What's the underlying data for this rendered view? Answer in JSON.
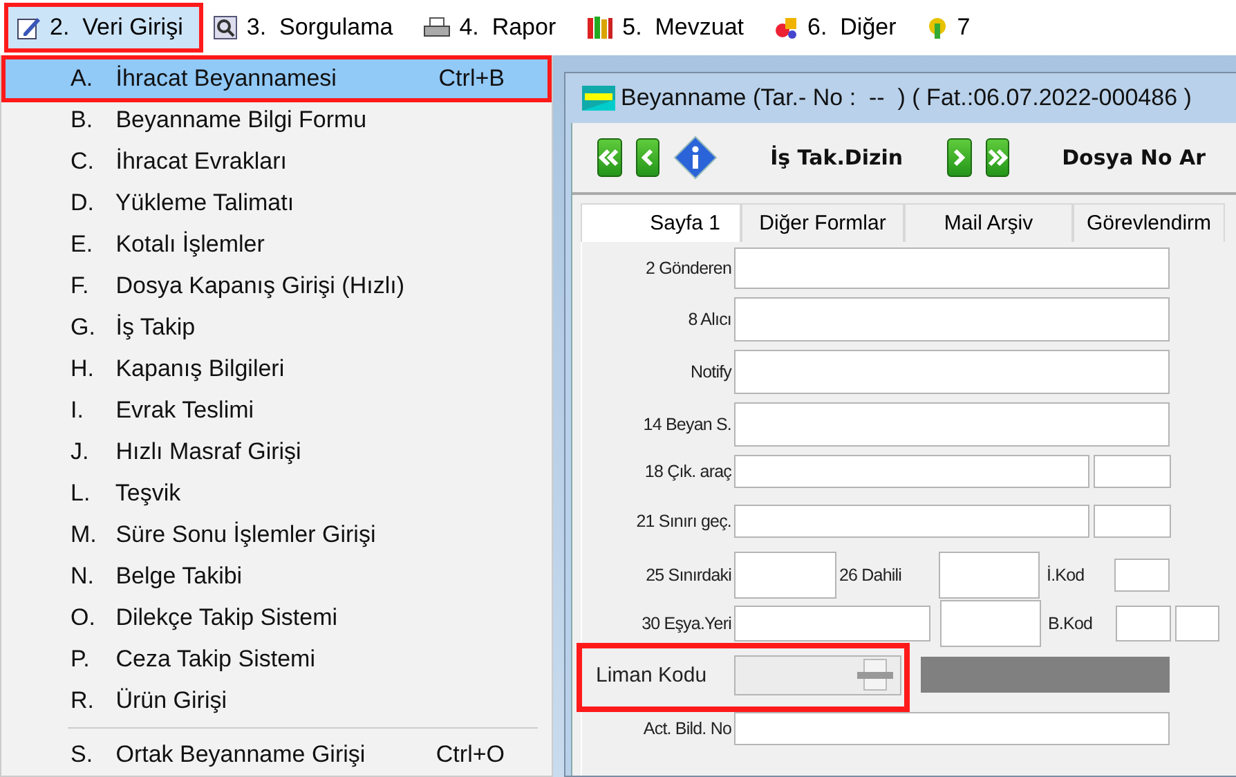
{
  "menubar": [
    {
      "label": "2.  Veri Girişi",
      "selected": true,
      "highlighted": true
    },
    {
      "label": "3.  Sorgulama",
      "selected": false,
      "highlighted": false
    },
    {
      "label": "4.  Rapor",
      "selected": false,
      "highlighted": false
    },
    {
      "label": "5.  Mevzuat",
      "selected": false,
      "highlighted": false
    },
    {
      "label": "6.  Diğer",
      "selected": false,
      "highlighted": false
    },
    {
      "label": "7",
      "selected": false,
      "highlighted": false
    }
  ],
  "menu": {
    "items": [
      {
        "kind": "item",
        "key": "A.",
        "label": "İhracat Beyannamesi",
        "shortcut": "Ctrl+B",
        "selected": true,
        "highlighted": true
      },
      {
        "kind": "item",
        "key": "B.",
        "label": "Beyanname Bilgi Formu",
        "selected": false,
        "highlighted": false
      },
      {
        "kind": "item",
        "key": "C.",
        "label": "İhracat Evrakları",
        "selected": false,
        "highlighted": false
      },
      {
        "kind": "item",
        "key": "D.",
        "label": "Yükleme Talimatı",
        "selected": false,
        "highlighted": false
      },
      {
        "kind": "item",
        "key": "E.",
        "label": "Kotalı İşlemler",
        "selected": false,
        "highlighted": false
      },
      {
        "kind": "item",
        "key": "F.",
        "label": "Dosya Kapanış Girişi (Hızlı)",
        "selected": false,
        "highlighted": false
      },
      {
        "kind": "item",
        "key": "G.",
        "label": "İş Takip",
        "selected": false,
        "highlighted": false
      },
      {
        "kind": "item",
        "key": "H.",
        "label": "Kapanış Bilgileri",
        "selected": false,
        "highlighted": false
      },
      {
        "kind": "item",
        "key": "I.",
        "label": "Evrak Teslimi",
        "selected": false,
        "highlighted": false
      },
      {
        "kind": "item",
        "key": "J.",
        "label": "Hızlı Masraf Girişi",
        "selected": false,
        "highlighted": false
      },
      {
        "kind": "item",
        "key": "L.",
        "label": "Teşvik",
        "selected": false,
        "highlighted": false
      },
      {
        "kind": "item",
        "key": "M.",
        "label": "Süre Sonu İşlemler Girişi",
        "selected": false,
        "highlighted": false
      },
      {
        "kind": "item",
        "key": "N.",
        "label": "Belge Takibi",
        "selected": false,
        "highlighted": false
      },
      {
        "kind": "item",
        "key": "O.",
        "label": "Dilekçe Takip Sistemi",
        "selected": false,
        "highlighted": false
      },
      {
        "kind": "item",
        "key": "P.",
        "label": "Ceza Takip Sistemi",
        "selected": false,
        "highlighted": false
      },
      {
        "kind": "item",
        "key": "R.",
        "label": "Ürün Girişi",
        "selected": false,
        "highlighted": false
      },
      {
        "kind": "separator"
      },
      {
        "kind": "item",
        "key": "S.",
        "label": "Ortak Beyanname Girişi",
        "shortcut": "Ctrl+O",
        "selected": false,
        "highlighted": false
      }
    ]
  },
  "window": {
    "title": "Beyanname (Tar.- No :  --  ) ( Fat.:06.07.2022-000486 )",
    "toolbar": [
      {
        "kind": "first"
      },
      {
        "kind": "prev"
      },
      {
        "kind": "info"
      },
      {
        "kind": "label",
        "label": "İş Tak.Dizin"
      },
      {
        "kind": "next"
      },
      {
        "kind": "last"
      },
      {
        "kind": "label",
        "label": "Dosya No Ar"
      }
    ],
    "tabs": [
      {
        "label": "Sayfa 1",
        "selected": true
      },
      {
        "label": "Diğer Formlar",
        "selected": false
      },
      {
        "label": "Mail Arşiv",
        "selected": false
      },
      {
        "label": "Görevlendirm",
        "selected": false
      }
    ],
    "form": [
      {
        "kind": "tall",
        "labels": [
          "2 Gönderen"
        ]
      },
      {
        "kind": "tall",
        "labels": [
          "8 Alıcı"
        ]
      },
      {
        "kind": "tall",
        "labels": [
          "Notify"
        ]
      },
      {
        "kind": "tall",
        "labels": [
          "14 Beyan S."
        ]
      },
      {
        "kind": "pair",
        "labels": [
          "18 Çık. araç"
        ]
      },
      {
        "kind": "pair",
        "labels": [
          "21 Sınırı geç."
        ]
      },
      {
        "kind": "dahili",
        "labels": [
          "25 Sınırdaki",
          "26 Dahili",
          "İ.Kod"
        ]
      },
      {
        "kind": "esya",
        "labels": [
          "30 Eşya.Yeri",
          "B.Kod"
        ]
      },
      {
        "kind": "combo",
        "labels": [
          "Liman Kodu"
        ],
        "disabled": true,
        "highlighted": true
      },
      {
        "kind": "single",
        "labels": [
          "Act. Bild. No"
        ]
      }
    ]
  }
}
